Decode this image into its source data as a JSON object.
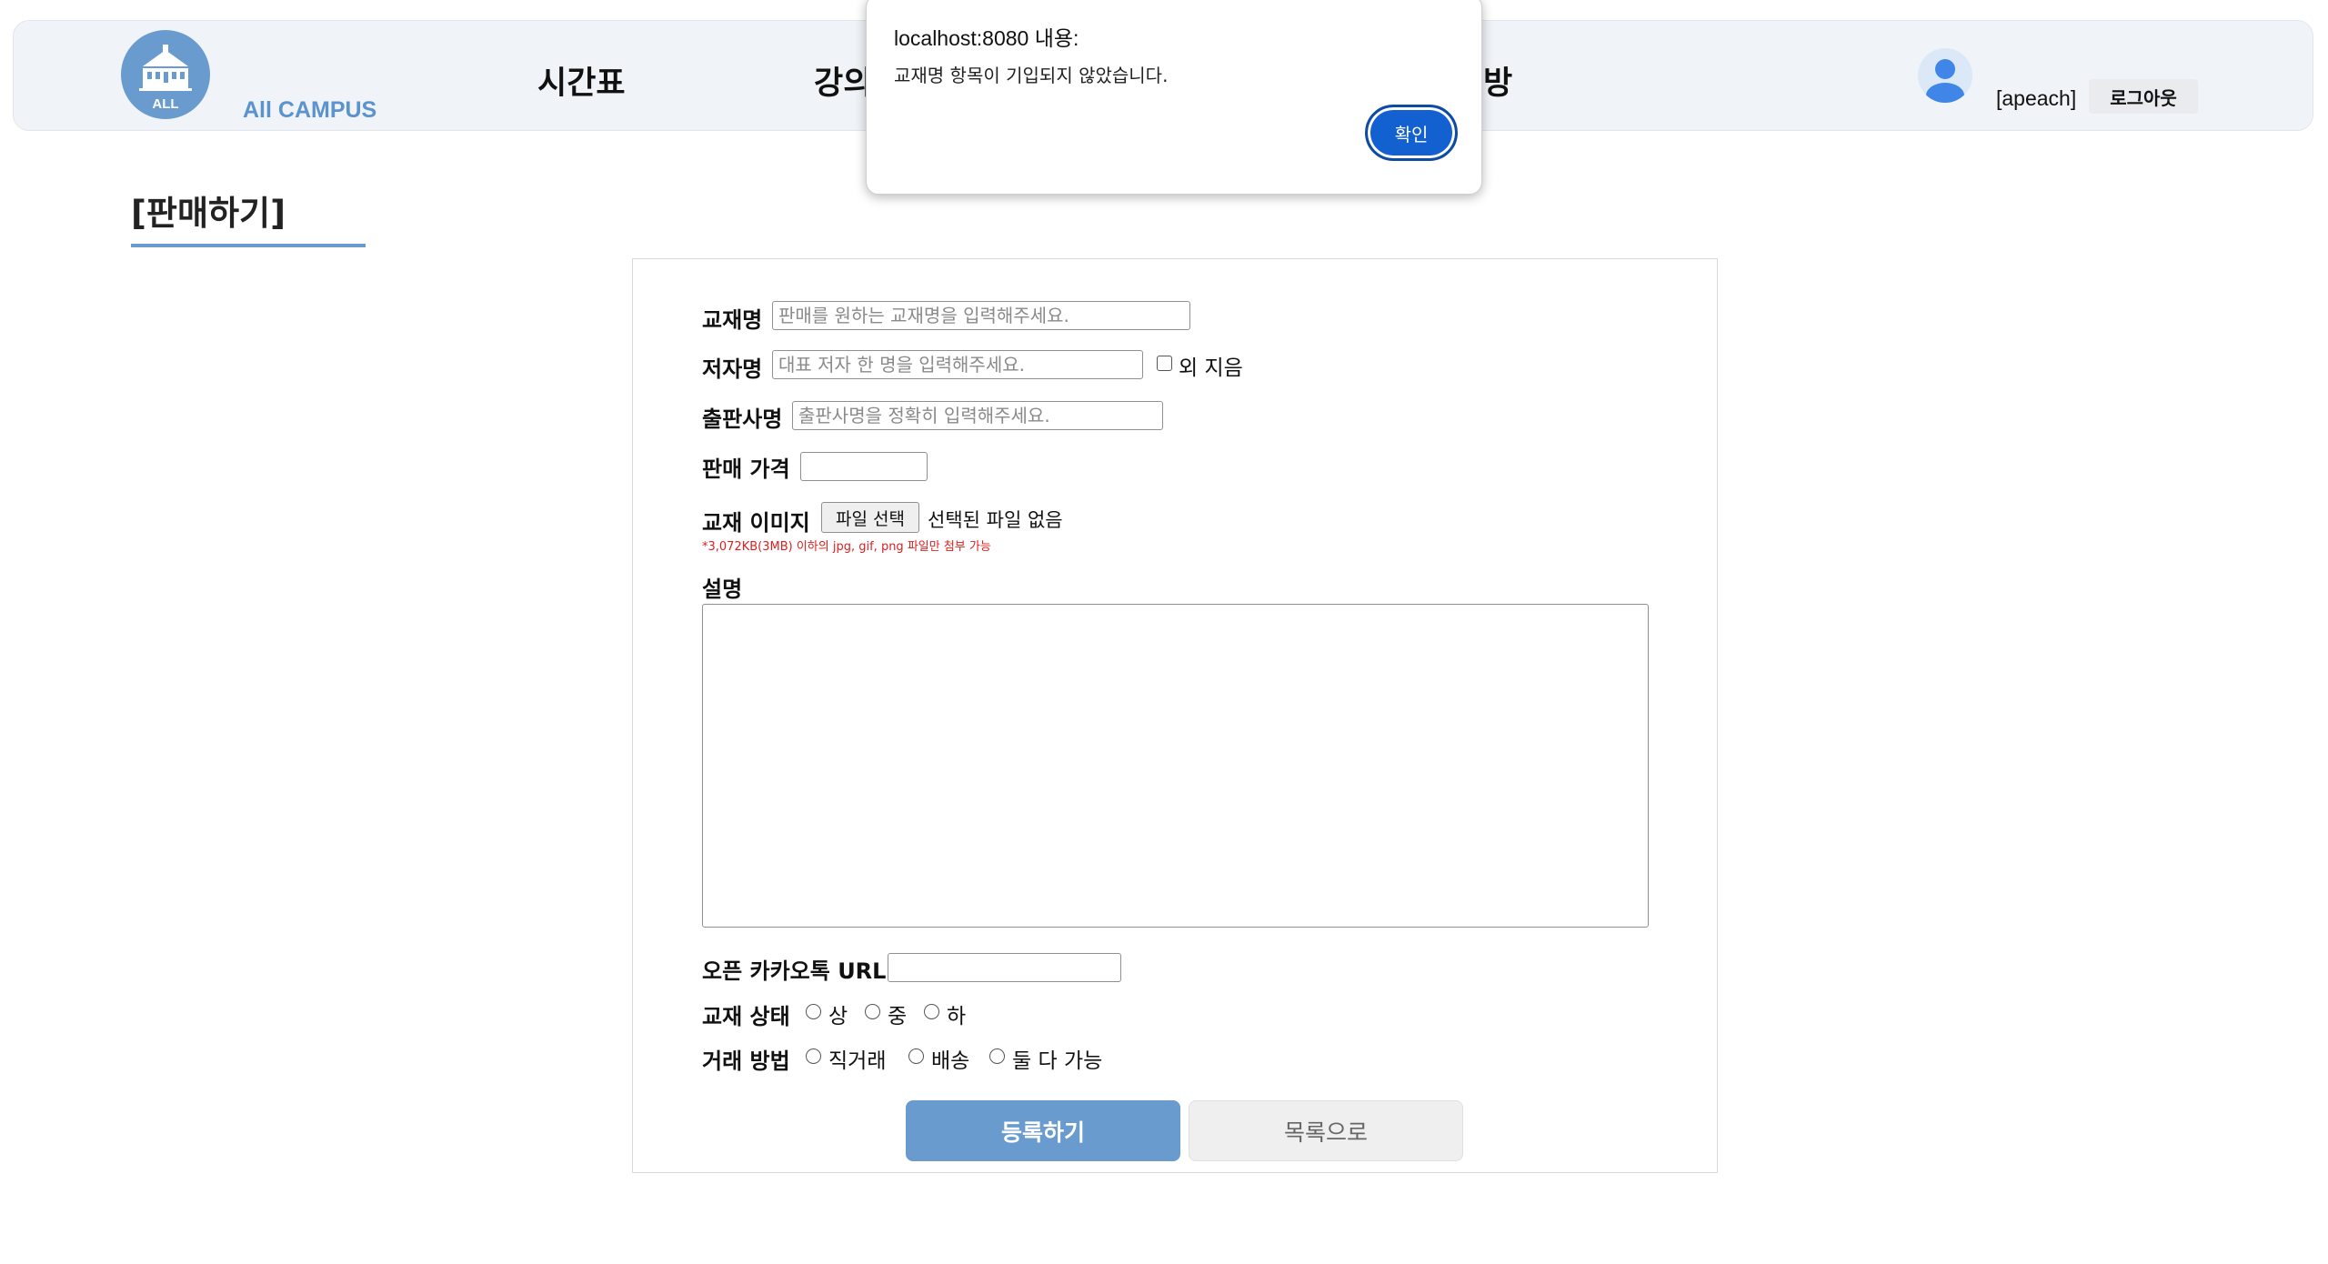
{
  "header": {
    "logo_badge": "ALL",
    "logo_text": "All CAMPUS",
    "nav": [
      "시간표",
      "강의",
      "방"
    ],
    "user": "[apeach]",
    "logout_label": "로그아웃"
  },
  "page": {
    "title": "[판매하기]"
  },
  "form": {
    "book_name_label": "교재명",
    "book_name_placeholder": "판매를 원하는 교재명을 입력해주세요.",
    "author_label": "저자명",
    "author_placeholder": "대표 저자 한 명을 입력해주세요.",
    "author_extra_label": "외 지음",
    "publisher_label": "출판사명",
    "publisher_placeholder": "출판사명을 정확히 입력해주세요.",
    "price_label": "판매 가격",
    "image_label": "교재 이미지",
    "file_button_label": "파일 선택",
    "file_status": "선택된 파일 없음",
    "image_note": "*3,072KB(3MB) 이하의 jpg, gif, png 파일만 첨부 가능",
    "description_label": "설명",
    "kakao_label": "오픈 카카오톡 URL",
    "condition_label": "교재 상태",
    "condition_options": [
      "상",
      "중",
      "하"
    ],
    "method_label": "거래 방법",
    "method_options": [
      "직거래",
      "배송",
      "둘 다 가능"
    ],
    "submit_label": "등록하기",
    "list_label": "목록으로"
  },
  "dialog": {
    "title": "localhost:8080 내용:",
    "message": "교재명 항목이 기입되지 않았습니다.",
    "ok_label": "확인"
  },
  "colors": {
    "accent": "#6a9bce",
    "header_bg": "#f0f3f7",
    "dialog_button": "#1361d0",
    "note_red": "#e02020"
  }
}
